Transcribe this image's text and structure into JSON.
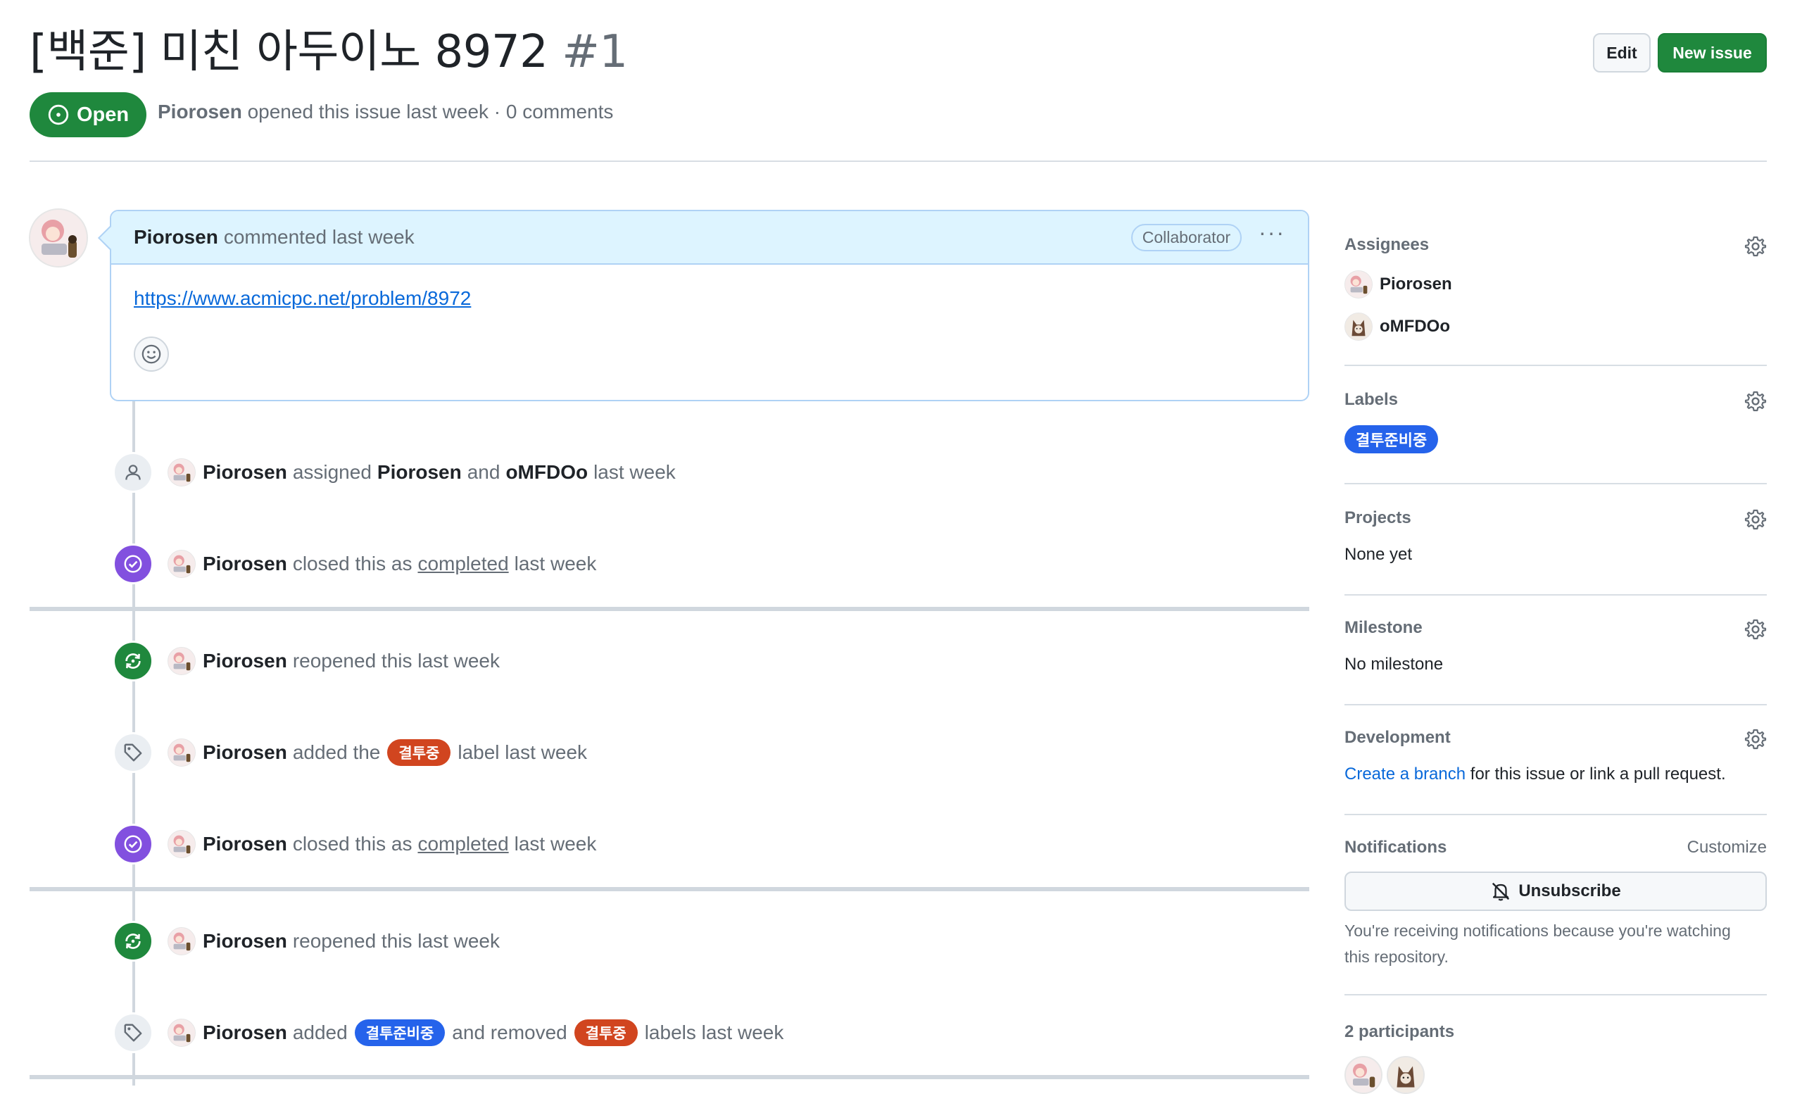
{
  "issue": {
    "title": "[백준] 미친 아두이노 8972",
    "number": "#1",
    "state": "Open",
    "author": "Piorosen",
    "meta_rest": "opened this issue last week · 0 comments",
    "edit_label": "Edit",
    "new_issue_label": "New issue"
  },
  "comment": {
    "author": "Piorosen",
    "action": "commented last week",
    "role_badge": "Collaborator",
    "link": "https://www.acmicpc.net/problem/8972"
  },
  "timeline": [
    {
      "type": "assigned",
      "icon": "person-icon",
      "actor": "Piorosen",
      "text1": "assigned",
      "target1": "Piorosen",
      "text2": "and",
      "target2": "oMFDOo",
      "text3": "last week"
    },
    {
      "type": "closed",
      "icon": "check-circle-icon",
      "actor": "Piorosen",
      "text1": "closed this as",
      "link": "completed",
      "text2": "last week"
    },
    {
      "type": "reopened",
      "icon": "sync-icon",
      "actor": "Piorosen",
      "text1": "reopened this last week"
    },
    {
      "type": "labeled",
      "icon": "tag-icon",
      "actor": "Piorosen",
      "text1": "added the",
      "label": "결투중",
      "text2": "label last week"
    },
    {
      "type": "closed",
      "icon": "check-circle-icon",
      "actor": "Piorosen",
      "text1": "closed this as",
      "link": "completed",
      "text2": "last week"
    },
    {
      "type": "reopened",
      "icon": "sync-icon",
      "actor": "Piorosen",
      "text1": "reopened this last week"
    },
    {
      "type": "relabeled",
      "icon": "tag-icon",
      "actor": "Piorosen",
      "text1": "added",
      "label_added": "결투준비중",
      "text2": "and removed",
      "label_removed": "결투중",
      "text3": "labels last week"
    }
  ],
  "sidebar": {
    "assignees": {
      "heading": "Assignees",
      "people": [
        "Piorosen",
        "oMFDOo"
      ]
    },
    "labels": {
      "heading": "Labels",
      "items": [
        "결투준비중"
      ]
    },
    "projects": {
      "heading": "Projects",
      "value": "None yet"
    },
    "milestone": {
      "heading": "Milestone",
      "value": "No milestone"
    },
    "development": {
      "heading": "Development",
      "link": "Create a branch",
      "rest": "for this issue or link a pull request."
    },
    "notifications": {
      "heading": "Notifications",
      "customize": "Customize",
      "button": "Unsubscribe",
      "note": "You're receiving notifications because you're watching this repository."
    },
    "participants": {
      "heading": "2 participants"
    }
  },
  "colors": {
    "open_green": "#1f883d",
    "closed_purple": "#8250df",
    "label_blue": "#2563eb",
    "label_red": "#d1451f",
    "link_blue": "#0969da",
    "comment_header_bg": "#ddf4ff"
  }
}
